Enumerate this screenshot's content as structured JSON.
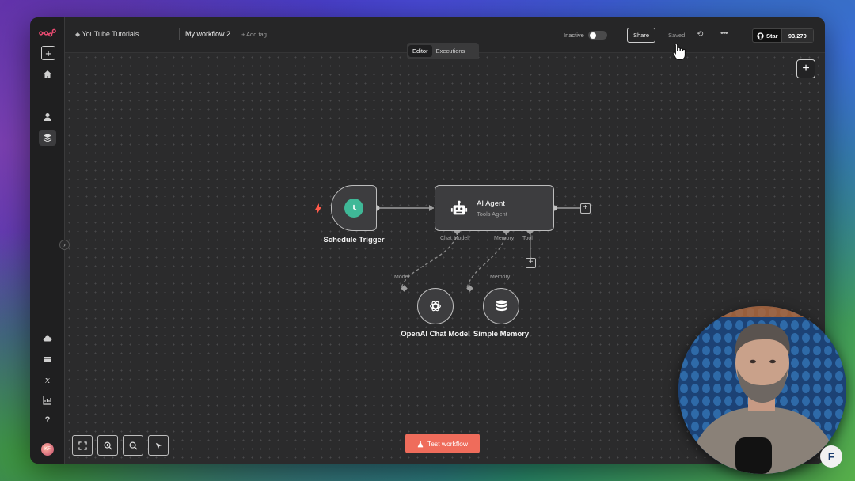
{
  "header": {
    "project": "YouTube Tutorials",
    "workflow_name": "My workflow 2",
    "add_tag": "+ Add tag",
    "status_label": "Inactive",
    "share_label": "Share",
    "saved_label": "Saved",
    "github_star_label": "Star",
    "github_star_count": "93,270"
  },
  "tabs": [
    {
      "label": "Editor",
      "active": true
    },
    {
      "label": "Executions",
      "active": false
    }
  ],
  "sidebar": {
    "avatar_initials": "KF"
  },
  "nodes": {
    "trigger": {
      "label": "Schedule Trigger"
    },
    "agent": {
      "title": "AI Agent",
      "subtitle": "Tools Agent",
      "handles": {
        "chat_model": "Chat Model*",
        "memory": "Memory",
        "tool": "Tool"
      }
    },
    "openai": {
      "label": "OpenAI Chat Model",
      "handle": "Model"
    },
    "memory": {
      "label": "Simple Memory",
      "handle": "Memory"
    }
  },
  "footer": {
    "test_button": "Test workflow"
  },
  "colors": {
    "accent": "#ef6c5b",
    "trigger_icon": "#3fb897",
    "trigger_bolt": "#ff5a4a"
  }
}
